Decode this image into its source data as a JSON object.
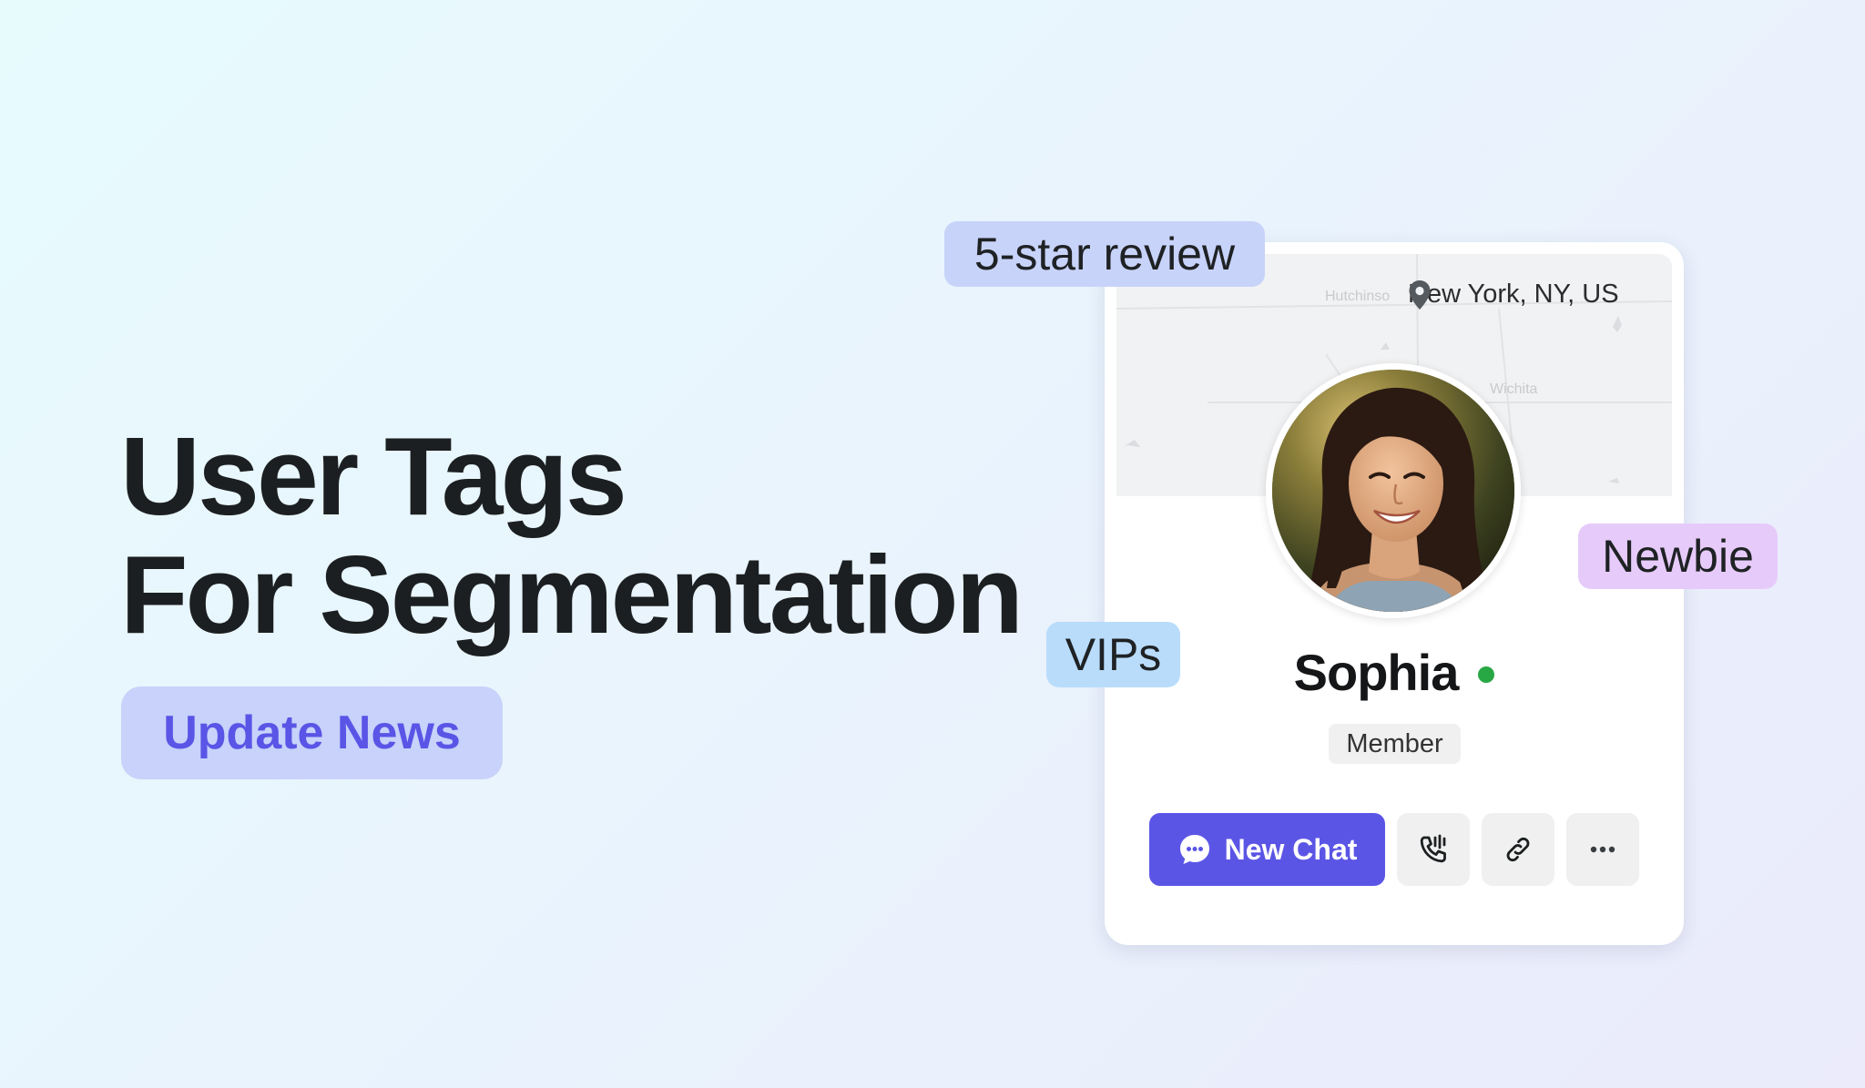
{
  "hero": {
    "title_line1": "User Tags",
    "title_line2": "For Segmentation",
    "badge": "Update News"
  },
  "tags": {
    "review": "5-star review",
    "newbie": "Newbie",
    "vips": "VIPs"
  },
  "profile": {
    "map": {
      "faint_label_1": "Hutchinso",
      "faint_label_2": "Wichita"
    },
    "location": "New York, NY, US",
    "name": "Sophia",
    "status": "online",
    "role": "Member",
    "actions": {
      "new_chat": "New Chat",
      "call_icon": "phone-call-icon",
      "link_icon": "link-icon",
      "more_icon": "more-horizontal-icon"
    }
  },
  "colors": {
    "accent": "#5b55e6",
    "online": "#28a745",
    "tag_review_bg": "#c8d3fa",
    "tag_newbie_bg": "#e6cbfa",
    "tag_vips_bg": "#b9dcfb",
    "badge_bg": "#c8d2fa",
    "badge_text": "#5a55e6"
  }
}
